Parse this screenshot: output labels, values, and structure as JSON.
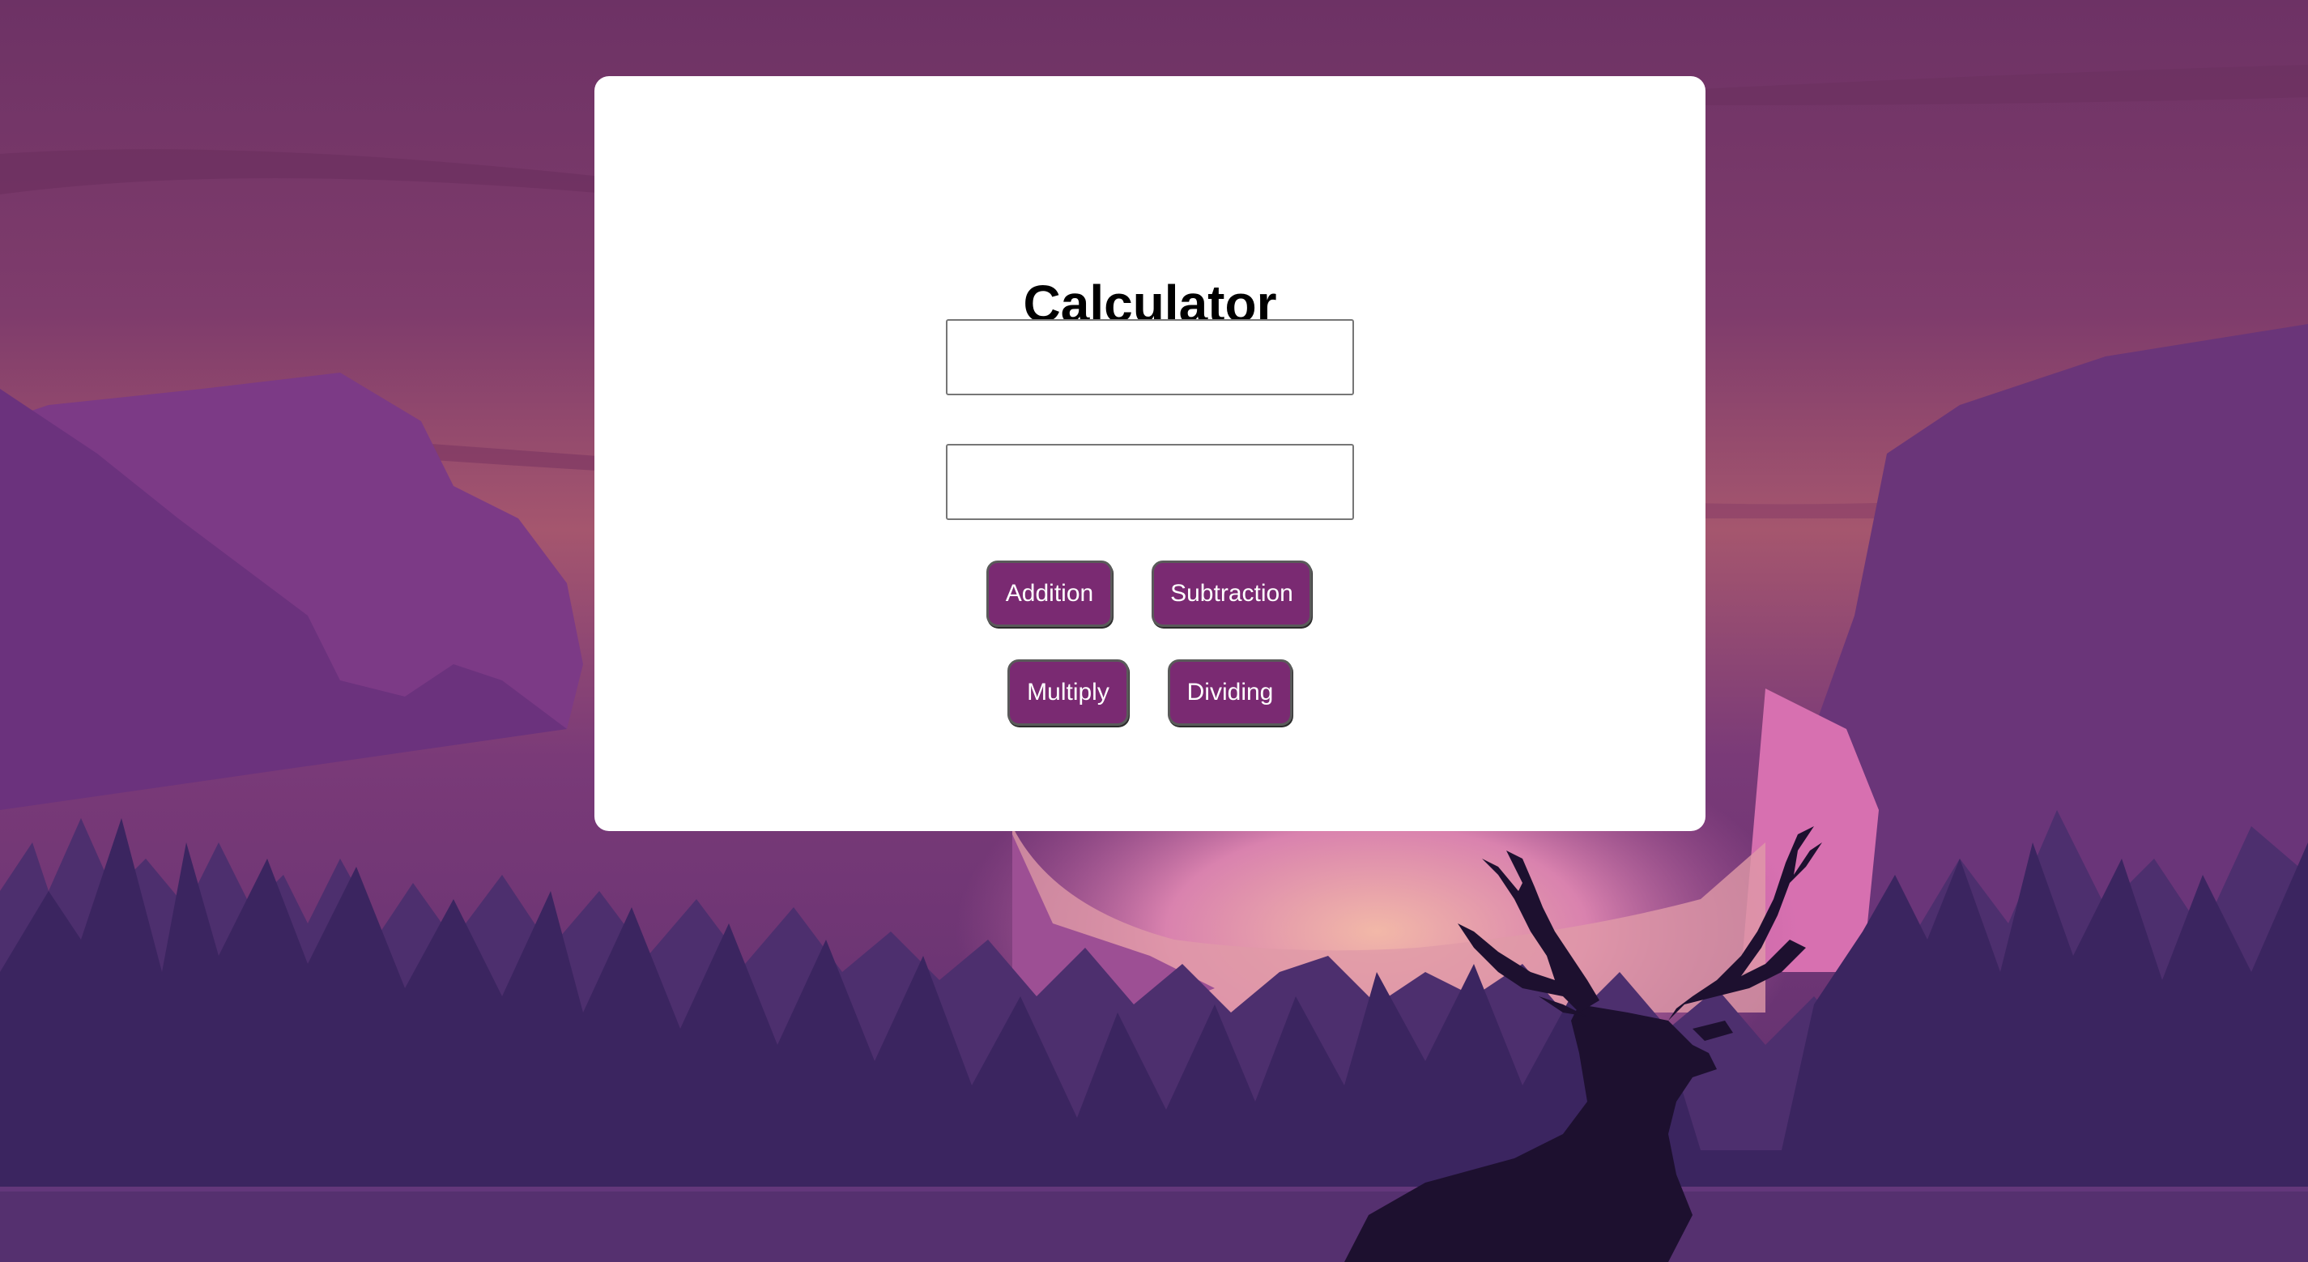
{
  "page": {
    "title": "Calculator"
  },
  "inputs": {
    "first": {
      "value": "",
      "placeholder": ""
    },
    "second": {
      "value": "",
      "placeholder": ""
    }
  },
  "buttons": {
    "addition": "Addition",
    "subtraction": "Subtraction",
    "multiply": "Multiply",
    "dividing": "Dividing"
  },
  "colors": {
    "button_background": "#7a2a72",
    "button_text": "#ffffff",
    "card_background": "#ffffff",
    "sky_top": "#6e3366",
    "sky_glow": "#e8a3a9",
    "mountain": "#6a3479",
    "forest": "#3d2860",
    "deer_silhouette": "#1e1130"
  },
  "background": {
    "scene": "purple-mountain-landscape-with-deer-silhouette"
  }
}
